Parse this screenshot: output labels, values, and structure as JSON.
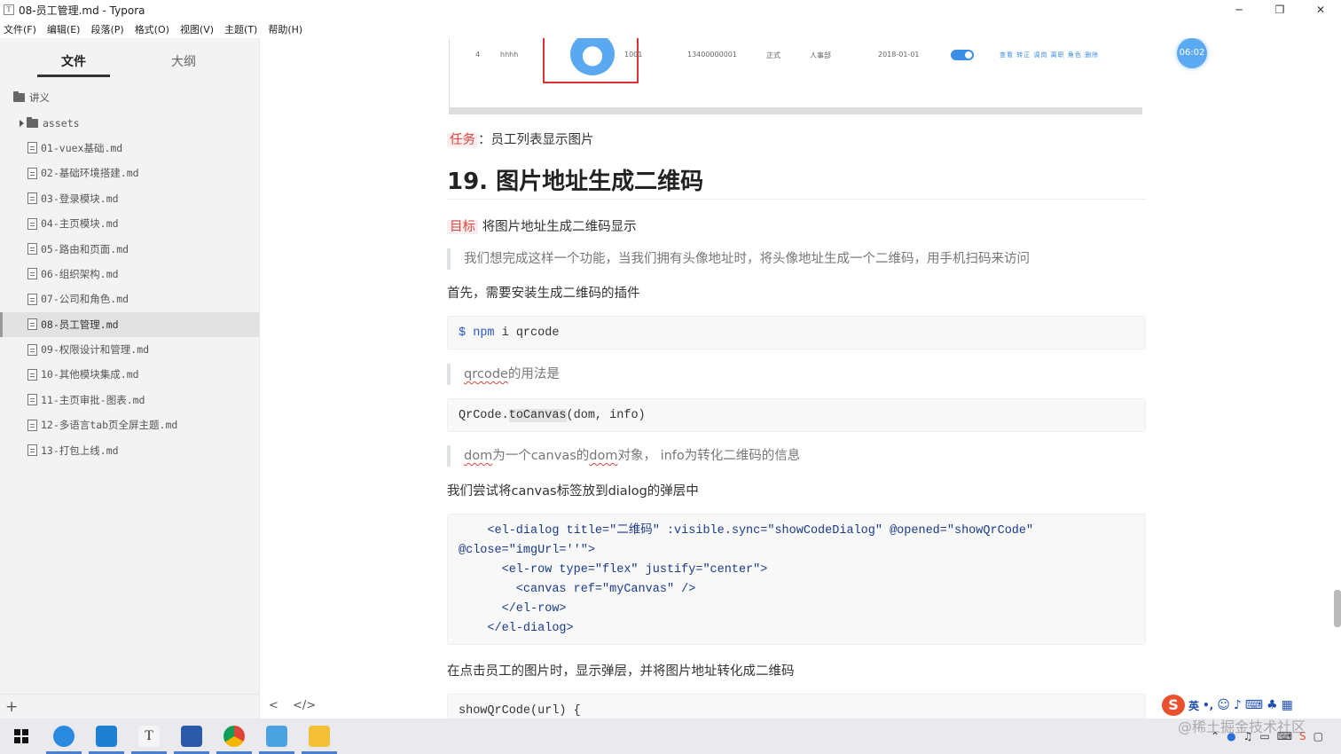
{
  "window": {
    "app_icon": "T",
    "title": "08-员工管理.md - Typora",
    "minimize": "─",
    "restore": "❐",
    "close": "✕"
  },
  "menu": [
    "文件(F)",
    "编辑(E)",
    "段落(P)",
    "格式(O)",
    "视图(V)",
    "主题(T)",
    "帮助(H)"
  ],
  "sidebar": {
    "tabs": [
      "文件",
      "大纲"
    ],
    "tree": [
      {
        "label": "讲义",
        "type": "folder"
      },
      {
        "label": "assets",
        "type": "subfolder"
      },
      {
        "label": "01-vuex基础.md",
        "type": "file"
      },
      {
        "label": "02-基础环境搭建.md",
        "type": "file"
      },
      {
        "label": "03-登录模块.md",
        "type": "file"
      },
      {
        "label": "04-主页模块.md",
        "type": "file"
      },
      {
        "label": "05-路由和页面.md",
        "type": "file"
      },
      {
        "label": "06-组织架构.md",
        "type": "file"
      },
      {
        "label": "07-公司和角色.md",
        "type": "file"
      },
      {
        "label": "08-员工管理.md",
        "type": "file",
        "active": true
      },
      {
        "label": "09-权限设计和管理.md",
        "type": "file"
      },
      {
        "label": "10-其他模块集成.md",
        "type": "file"
      },
      {
        "label": "11-主页审批-图表.md",
        "type": "file"
      },
      {
        "label": "12-多语言tab页全屏主题.md",
        "type": "file"
      },
      {
        "label": "13-打包上线.md",
        "type": "file"
      }
    ],
    "add": "+"
  },
  "screenshot_row": {
    "index": "4",
    "name": "hhhh",
    "number": "1001",
    "phone": "13400000001",
    "type": "正式",
    "dept": "人事部",
    "date": "2018-01-01",
    "ops": "查看 转正 调岗 离职 角色 删除",
    "timer": "06:02"
  },
  "doc": {
    "task_tag": "任务",
    "task_text": "：员工列表显示图片",
    "heading": "19. 图片地址生成二维码",
    "goal_tag": "目标",
    "goal_text": "将图片地址生成二维码显示",
    "quote1": "我们想完成这样一个功能，当我们拥有头像地址时，将头像地址生成一个二维码，用手机扫码来访问",
    "para1": "首先，需要安装生成二维码的插件",
    "code1": {
      "dollar": "$",
      "cmd": "npm",
      "args": " i qrcode"
    },
    "quote2_a": "qrcode",
    "quote2_b": "的用法是",
    "code2": {
      "a": "QrCode.",
      "b": "toCanvas",
      "c": "(dom, info)"
    },
    "quote3_a": "dom",
    "quote3_b": "为一个canvas的",
    "quote3_c": "dom",
    "quote3_d": "对象， info为转化二维码的信息",
    "para2": "我们尝试将canvas标签放到dialog的弹层中",
    "code3": [
      "    <el-dialog title=\"二维码\" :visible.sync=\"showCodeDialog\" @opened=\"showQrCode\"",
      "@close=\"imgUrl=''\">",
      "      <el-row type=\"flex\" justify=\"center\">",
      "        <canvas ref=\"myCanvas\" />",
      "      </el-row>",
      "    </el-dialog>"
    ],
    "para3": "在点击员工的图片时，显示弹层，并将图片地址转化成二维码",
    "code4": "showQrCode(url) {"
  },
  "editor_nav": {
    "back": "<",
    "source": "</>"
  },
  "ime": {
    "logo": "S",
    "lang": "英",
    "dot": "•,"
  },
  "watermark": "@稀土掘金技术社区",
  "tray": {
    "time_placeholder": ""
  }
}
